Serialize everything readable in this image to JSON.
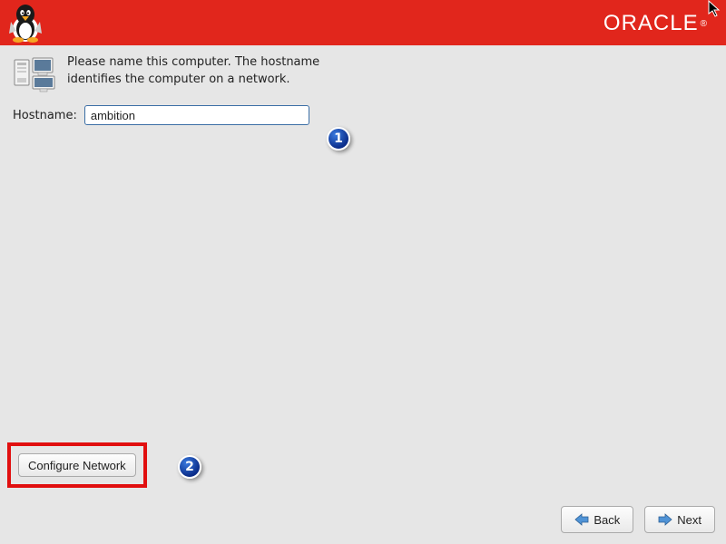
{
  "header": {
    "brand": "ORACLE"
  },
  "intro": {
    "text": "Please name this computer.  The hostname identifies the computer on a network."
  },
  "hostname": {
    "label": "Hostname:",
    "value": "ambition"
  },
  "annotations": {
    "one": "1",
    "two": "2"
  },
  "buttons": {
    "configure_network": "Configure Network",
    "back": "Back",
    "next": "Next"
  }
}
